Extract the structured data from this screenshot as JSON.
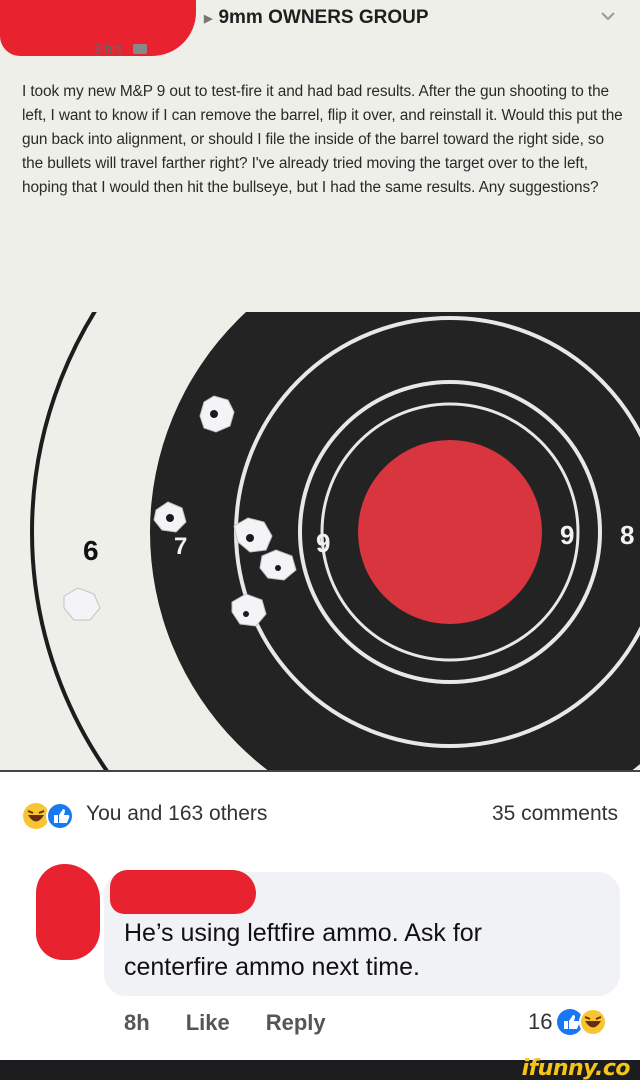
{
  "post": {
    "group_name": "9mm OWNERS GROUP",
    "time": "3 hrs",
    "body": "I took my new M&P 9 out to test-fire it and had bad results. After the gun shooting to the left, I want to know if I can remove the barrel, flip it over, and reinstall it. Would this put the gun back into alignment, or should I file the inside of the barrel toward the right side, so the bullets will travel farther right? I've already tried moving the target over to the left, hoping that I would then hit the bullseye, but I had the same results. Any suggestions?"
  },
  "target": {
    "ring_labels": [
      "6",
      "7",
      "9",
      "9",
      "8"
    ],
    "colors": {
      "paper": "#eeefe9",
      "black": "#232324",
      "bullseye": "#d9353f"
    }
  },
  "reactions": {
    "text": "You and 163 others",
    "comments": "35 comments",
    "icons": [
      "haha-icon",
      "like-icon"
    ]
  },
  "comment": {
    "text": "He’s using leftfire ammo. Ask for centerfire ammo next time.",
    "time": "8h",
    "like_label": "Like",
    "reply_label": "Reply",
    "reaction_count": "16"
  },
  "footer": {
    "brand": "ifunny.co"
  },
  "colors": {
    "redaction": "#e8232f",
    "like_blue": "#1877f2",
    "haha_yellow": "#f7c531"
  }
}
